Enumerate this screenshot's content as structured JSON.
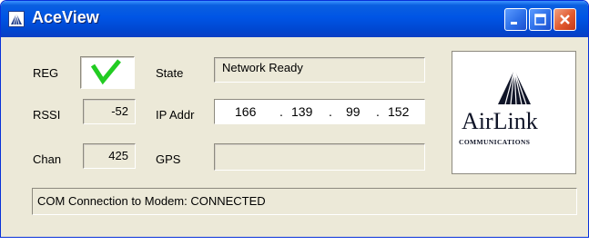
{
  "window": {
    "title": "AceView"
  },
  "fields": {
    "reg_label": "REG",
    "rssi_label": "RSSI",
    "rssi_value": "-52",
    "chan_label": "Chan",
    "chan_value": "425",
    "state_label": "State",
    "state_value": "Network Ready",
    "ip_label": "IP Addr",
    "ip_octets": [
      "166",
      "139",
      "99",
      "152"
    ],
    "gps_label": "GPS",
    "gps_value": ""
  },
  "icons": {
    "app": "airlink-logo-icon",
    "registered": "green-checkmark-icon",
    "minimize": "minimize-icon",
    "maximize": "maximize-icon",
    "close": "close-icon"
  },
  "logo": {
    "word": "AirLink",
    "sub": "COMMUNICATIONS"
  },
  "status": {
    "text": "COM Connection to Modem: CONNECTED"
  },
  "colors": {
    "titlebar": "#0055e5",
    "check": "#22cc22",
    "close_button": "#e15a2e"
  }
}
